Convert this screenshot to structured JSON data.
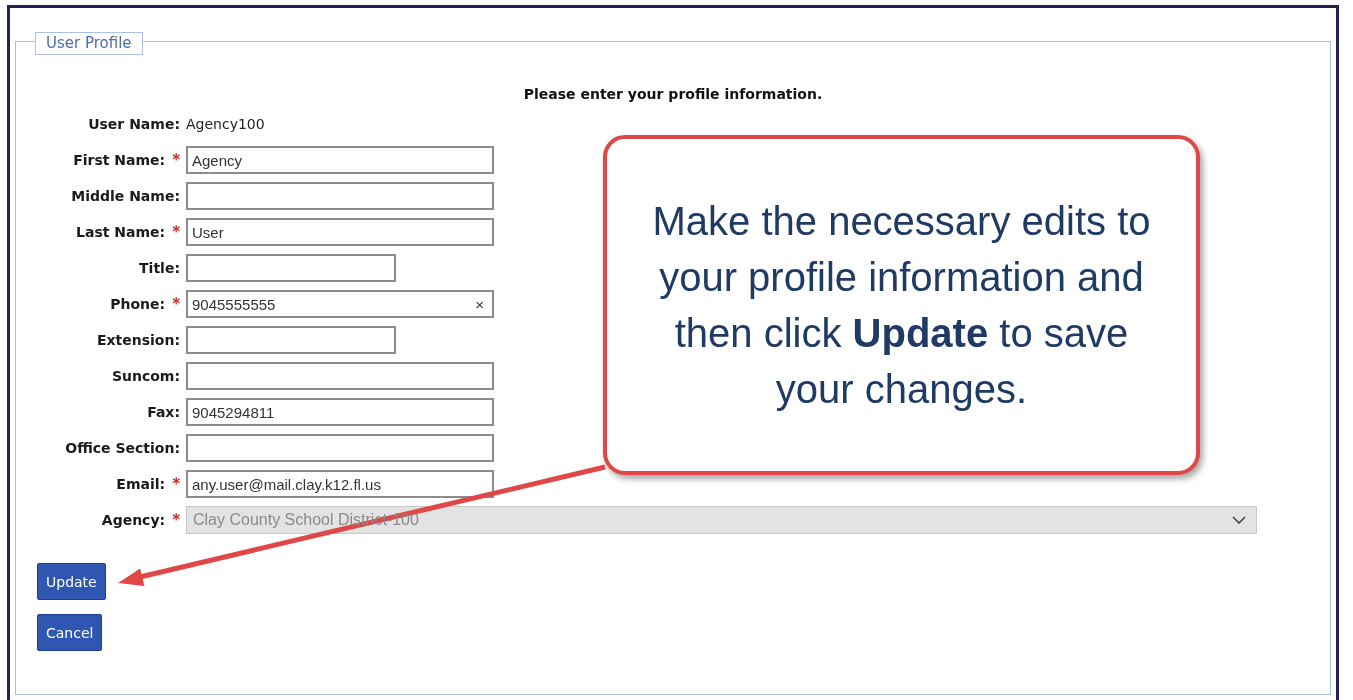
{
  "legend": "User Profile",
  "heading": "Please enter your profile information.",
  "fields": [
    {
      "kind": "static",
      "label": "User Name:",
      "required": false,
      "value": "Agency100"
    },
    {
      "kind": "text",
      "label": "First Name:",
      "required": true,
      "value": "Agency",
      "wide": true
    },
    {
      "kind": "text",
      "label": "Middle Name:",
      "required": false,
      "wide": true
    },
    {
      "kind": "text",
      "label": "Last Name:",
      "required": true,
      "value": "User",
      "wide": true
    },
    {
      "kind": "text",
      "label": "Title:",
      "required": false,
      "wide": false
    },
    {
      "kind": "text",
      "label": "Phone:",
      "required": true,
      "value": "9045555555",
      "wide": true,
      "clear": "×"
    },
    {
      "kind": "text",
      "label": "Extension:",
      "required": false,
      "wide": false
    },
    {
      "kind": "text",
      "label": "Suncom:",
      "required": false,
      "wide": true
    },
    {
      "kind": "text",
      "label": "Fax:",
      "required": false,
      "value": "9045294811",
      "wide": true
    },
    {
      "kind": "text",
      "label": "Office Section:",
      "required": false,
      "wide": true
    },
    {
      "kind": "text",
      "label": "Email:",
      "required": true,
      "value": "any.user@mail.clay.k12.fl.us",
      "wide": true
    },
    {
      "kind": "select",
      "label": "Agency:",
      "required": true,
      "value": "Clay County School District-100",
      "disabled": true
    }
  ],
  "required_mark": "*",
  "buttons": [
    "Update",
    "Cancel"
  ],
  "callout": "Make the necessary edits to your profile information and then click **Update** to save your changes."
}
